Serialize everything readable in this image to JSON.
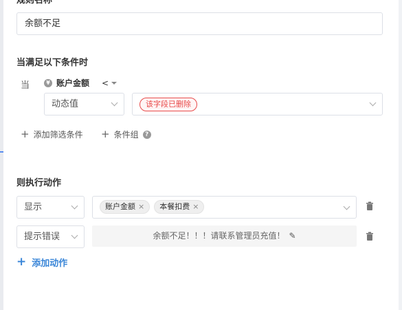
{
  "rule_name": {
    "label": "规则名称",
    "value": "余额不足"
  },
  "condition": {
    "title": "当满足以下条件时",
    "when_label": "当",
    "field_icon": "coin-icon",
    "field_name": "账户金额",
    "operator": "<",
    "value_type": "动态值",
    "value_tag": "该字段已删除",
    "add_filter_label": "添加筛选条件",
    "add_group_label": "条件组"
  },
  "actions": {
    "title": "则执行动作",
    "rows": [
      {
        "type": "显示",
        "tags": [
          "账户金额",
          "本餐扣费"
        ]
      },
      {
        "type": "提示错误",
        "message": "余额不足！！！请联系管理员充值！"
      }
    ],
    "add_action_label": "添加动作"
  },
  "colors": {
    "accent": "#3a86d8",
    "danger": "#e84a4a"
  }
}
